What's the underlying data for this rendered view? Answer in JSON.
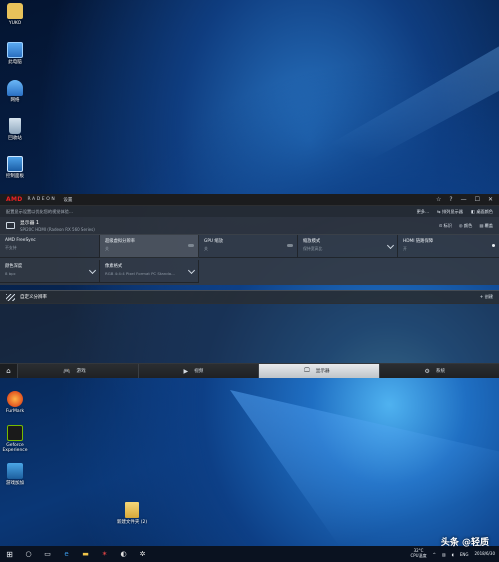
{
  "desktop": {
    "icons": [
      {
        "label": "YUKO"
      },
      {
        "label": "此电脑"
      },
      {
        "label": "网络"
      },
      {
        "label": "回收站"
      },
      {
        "label": "控制面板"
      },
      {
        "label": "FurMark"
      },
      {
        "label": "Geforce Experience"
      },
      {
        "label": "游戏加加"
      },
      {
        "label": "新建文件夹 (2)"
      }
    ]
  },
  "radeon": {
    "brand": "AMD",
    "product": "RADEON",
    "title": "设置",
    "window_controls": [
      "☆",
      "?",
      "—",
      "☐",
      "✕"
    ],
    "hint": "配置显示设置以优化您的视觉体验…",
    "toolbar_actions": [
      "更多…",
      "排列显示器",
      "桌面颜色"
    ],
    "display": {
      "name": "显示器 1",
      "subtitle": "SPI20C HDMI (Radeon RX 560 Series)",
      "actions": [
        "标识",
        "颜色",
        "覆盖"
      ]
    },
    "settings": [
      {
        "label": "AMD FreeSync",
        "value": "不支持"
      },
      {
        "label": "超级虚拟分辨率",
        "value": "关"
      },
      {
        "label": "GPU 缩放",
        "value": "关"
      },
      {
        "label": "缩放模式",
        "value": "保持宽高比"
      },
      {
        "label": "HDMI 链路保障",
        "value": "开"
      },
      {
        "label": "颜色深度",
        "value": "8 bpc"
      },
      {
        "label": "像素格式",
        "value": "RGB 4:4:4 Pixel Format PC Standa..."
      }
    ],
    "custom_resolution": {
      "label": "自定义分辨率",
      "action": "+ 创建"
    },
    "nav": {
      "home_icon": "⌂",
      "tabs": [
        {
          "label": "游戏",
          "icon": "🎮"
        },
        {
          "label": "视频",
          "icon": "▶"
        },
        {
          "label": "显示器",
          "icon": "🖵"
        },
        {
          "label": "系统",
          "icon": "⚙"
        }
      ],
      "active": "显示器"
    }
  },
  "taskbar": {
    "temp_value": "32°C",
    "temp_label": "CPU温度",
    "lang": "ENG",
    "time": "",
    "date": "2018/6/30"
  },
  "watermark": "头条 @轻质"
}
